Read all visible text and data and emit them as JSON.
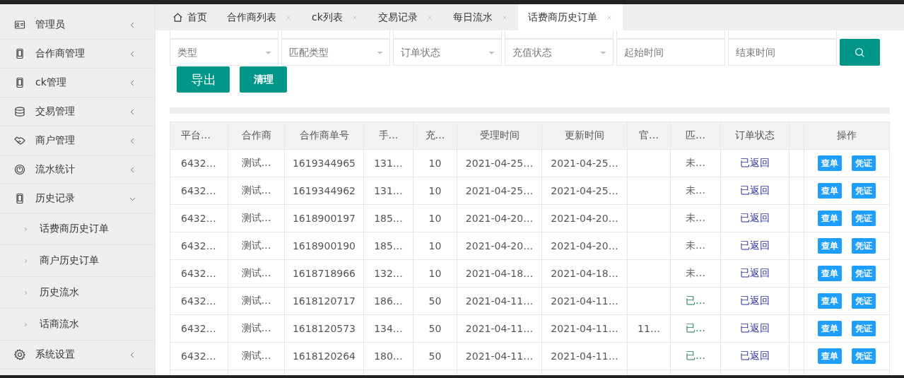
{
  "sidebar": {
    "items": [
      {
        "label": "管理员",
        "expanded": false
      },
      {
        "label": "合作商管理",
        "expanded": false
      },
      {
        "label": "ck管理",
        "expanded": false
      },
      {
        "label": "交易管理",
        "expanded": false
      },
      {
        "label": "商户管理",
        "expanded": false
      },
      {
        "label": "流水统计",
        "expanded": false
      },
      {
        "label": "历史记录",
        "expanded": true,
        "children": [
          {
            "label": "话费商历史订单"
          },
          {
            "label": "商户历史订单"
          },
          {
            "label": "历史流水"
          },
          {
            "label": "话商流水"
          }
        ]
      },
      {
        "label": "系统设置",
        "expanded": false
      }
    ]
  },
  "tabs": [
    {
      "label": "首页",
      "selected": false,
      "closable": false
    },
    {
      "label": "合作商列表",
      "selected": false,
      "closable": true
    },
    {
      "label": "ck列表",
      "selected": false,
      "closable": true
    },
    {
      "label": "交易记录",
      "selected": false,
      "closable": true
    },
    {
      "label": "每日流水",
      "selected": false,
      "closable": true
    },
    {
      "label": "话费商历史订单",
      "selected": true,
      "closable": true
    }
  ],
  "filters": [
    {
      "kind": "select",
      "placeholder": "类型"
    },
    {
      "kind": "select",
      "placeholder": "匹配类型"
    },
    {
      "kind": "select",
      "placeholder": "订单状态"
    },
    {
      "kind": "select",
      "placeholder": "充值状态"
    },
    {
      "kind": "text",
      "placeholder": "起始时间"
    },
    {
      "kind": "text",
      "placeholder": "结束时间"
    }
  ],
  "buttons": [
    {
      "label": "导出",
      "kind": "large"
    },
    {
      "label": "清理",
      "kind": "small"
    }
  ],
  "table": {
    "columns": [
      "平台…",
      "合作商",
      "合作商单号",
      "手…",
      "充…",
      "受理时间",
      "更新时间",
      "官…",
      "匹…",
      "订单状态"
    ],
    "actions_column": "操作",
    "rows": [
      {
        "cells": [
          "6432…",
          "测试…",
          "1619344965",
          "131…",
          "10",
          "2021-04-25…",
          "2021-04-25…",
          null,
          {
            "text": "未…",
            "color": "#666666"
          },
          "已返回"
        ],
        "actions": [
          "查单",
          "凭证"
        ]
      },
      {
        "cells": [
          "6432…",
          "测试…",
          "1619344962",
          "131…",
          "10",
          "2021-04-25…",
          "2021-04-25…",
          null,
          {
            "text": "未…",
            "color": "#666666"
          },
          "已返回"
        ],
        "actions": [
          "查单",
          "凭证"
        ]
      },
      {
        "cells": [
          "6432…",
          "测试…",
          "1618900197",
          "185…",
          "10",
          "2021-04-20…",
          "2021-04-20…",
          null,
          {
            "text": "未…",
            "color": "#666666"
          },
          "已返回"
        ],
        "actions": [
          "查单",
          "凭证"
        ]
      },
      {
        "cells": [
          "6432…",
          "测试…",
          "1618900190",
          "185…",
          "10",
          "2021-04-20…",
          "2021-04-20…",
          null,
          {
            "text": "未…",
            "color": "#666666"
          },
          "已返回"
        ],
        "actions": [
          "查单",
          "凭证"
        ]
      },
      {
        "cells": [
          "6432…",
          "测试…",
          "1618718966",
          "132…",
          "10",
          "2021-04-18…",
          "2021-04-18…",
          null,
          {
            "text": "未…",
            "color": "#666666"
          },
          "已返回"
        ],
        "actions": [
          "查单",
          "凭证"
        ]
      },
      {
        "cells": [
          "6432…",
          "测试…",
          "1618120717",
          "186…",
          "50",
          "2021-04-11…",
          "2021-04-11…",
          null,
          {
            "text": "已…",
            "color": "#1f7a5a"
          },
          "已返回"
        ],
        "actions": [
          "查单",
          "凭证"
        ]
      },
      {
        "cells": [
          "6432…",
          "测试…",
          "1618120573",
          "134…",
          "50",
          "2021-04-11…",
          "2021-04-11…",
          "11…",
          {
            "text": "已…",
            "color": "#1f7a5a"
          },
          "已返回"
        ],
        "actions": [
          "查单",
          "凭证"
        ]
      },
      {
        "cells": [
          "6432…",
          "测试…",
          "1618120264",
          "180…",
          "50",
          "2021-04-11…",
          "2021-04-11…",
          null,
          {
            "text": "已…",
            "color": "#1f7a5a"
          },
          "已返回"
        ],
        "actions": [
          "查单",
          "凭证"
        ]
      }
    ]
  }
}
